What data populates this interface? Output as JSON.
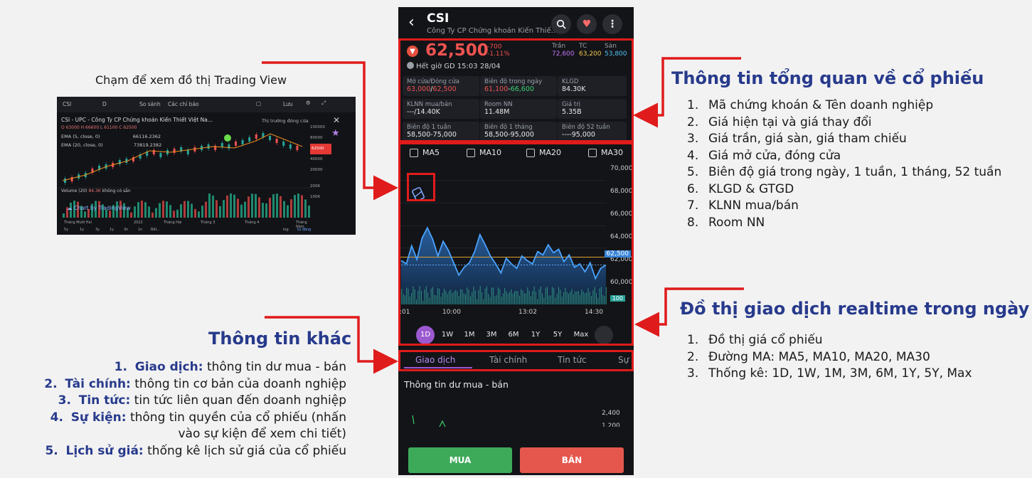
{
  "phone": {
    "symbol": "CSI",
    "company": "Công Ty CP Chứng khoán Kiến Thiế...",
    "price": "62,500",
    "change_abs": "-700",
    "change_pct": "-1.11%",
    "ceiling_label": "Trần",
    "ceiling": "72,600",
    "ref_label": "TC",
    "ref": "63,200",
    "floor_label": "Sàn",
    "floor": "53,800",
    "time": "Hết giờ GD 15:03 28/04",
    "cells": [
      {
        "label": "Mở cửa/Đóng cửa",
        "value_a": "63,000",
        "value_sep": "/",
        "value_b": "62,500",
        "color_a": "#ef5350",
        "color_b": "#ef5350"
      },
      {
        "label": "Biên độ trong ngày",
        "value_a": "61,100",
        "value_sep": "-",
        "value_b": "66,600",
        "color_a": "#ef5350",
        "color_b": "#3ecf6d"
      },
      {
        "label": "KLGD",
        "value": "84.30K"
      },
      {
        "label": "KLNN mua/bán",
        "value": "---/14.40K"
      },
      {
        "label": "Room NN",
        "value": "11.48M"
      },
      {
        "label": "Giá trị",
        "value": "5.35B"
      },
      {
        "label": "Biên độ 1 tuần",
        "value": "58,500-75,000"
      },
      {
        "label": "Biên độ 1 tháng",
        "value": "58,500-95,000"
      },
      {
        "label": "Biên độ 52 tuần",
        "value": "----95,000"
      }
    ],
    "ma": [
      "MA5",
      "MA10",
      "MA20",
      "MA30"
    ],
    "y_ticks": [
      "70,000",
      "68,000",
      "66,000",
      "64,000",
      "62,000",
      "60,000"
    ],
    "x_ticks": [
      ":01",
      "10:00",
      "13:02",
      "14:30"
    ],
    "current_tag": "62,500",
    "volume_tag": "100",
    "periods": [
      "1D",
      "1W",
      "1M",
      "3M",
      "6M",
      "1Y",
      "5Y",
      "Max"
    ],
    "tabs": [
      "Giao dịch",
      "Tài chính",
      "Tin tức",
      "Sự"
    ],
    "subsection": "Thông tin dư mua - bán",
    "mini_ticks": [
      "2,400",
      "1,200"
    ],
    "buy": "MUA",
    "sell": "BÁN"
  },
  "chart_data": {
    "type": "line",
    "title": "",
    "xlabel": "",
    "ylabel": "",
    "x": [
      ":01",
      "10:00",
      "13:02",
      "14:30"
    ],
    "ylim": [
      59000,
      71000
    ],
    "reference_line": 63200,
    "last_value": 62500,
    "series": [
      {
        "values": [
          62900,
          62600,
          64200,
          63000,
          64900,
          65800,
          64800,
          63300,
          64600,
          63800,
          62700,
          61600,
          62300,
          62700,
          63700,
          65200,
          64300,
          63300,
          62600,
          61800,
          63100,
          62600,
          62200,
          63300,
          62900,
          62600,
          63700,
          63400,
          64300,
          63600,
          63900,
          62800,
          63400,
          62300,
          62600,
          61900,
          62700,
          61300,
          62200,
          62500
        ]
      }
    ]
  },
  "tradingview": {
    "caption": "Chạm để xem đồ thị Trading View",
    "symbol": "CSI",
    "interval": "D",
    "compare": "So sánh",
    "indicators": "Các chỉ báo",
    "save": "Lưu",
    "title": "CSI - UPC - Công Ty CP Chứng khoán Kiến Thiết Việt Na...",
    "market": "Thị trường đóng cửa",
    "ohlc": "O 63000  H 66600  L 61100  C 62500",
    "ema1": "EMA (5, close, 0)",
    "ema2": "EMA (20, close, 0)",
    "ema1_val": "66116.2362",
    "ema2_val": "73819.2382",
    "volume_label": "Volume (20)",
    "volume_val": "84.3K",
    "volume_na": "không có sẵn",
    "watermark": "Chart by TradingView",
    "y_ticks": [
      "100000",
      "80000",
      "62500",
      "40000",
      "20000"
    ],
    "vol_ticks": [
      "200K",
      "100K"
    ],
    "x_ticks": [
      "Tháng Mười Hai",
      "2022",
      "Tháng Hai",
      "Tháng 3",
      "Tháng 4",
      "Tháng Năm"
    ],
    "ranges": [
      "5y",
      "1y",
      "3y",
      "1y",
      "3n",
      "1n",
      "Bắt..."
    ],
    "log": "log",
    "auto": "tự động"
  },
  "annotations": {
    "overview_title": "Thông tin tổng quan về cổ phiếu",
    "overview_items": [
      "Mã chứng khoán & Tên doanh nghiệp",
      "Giá hiện tại và giá thay đổi",
      "Giá trần, giá sàn, giá tham chiếu",
      "Giá mở cửa, đóng cửa",
      "Biên độ giá trong ngày, 1 tuần, 1 tháng, 52 tuần",
      "KLGD & GTGD",
      "KLNN mua/bán",
      "Room NN"
    ],
    "realtime_title": "Đồ thị giao dịch realtime trong ngày",
    "realtime_items": [
      "Đồ thị giá cổ phiếu",
      "Đường MA: MA5, MA10, MA20, MA30",
      "Thống kê: 1D, 1W, 1M, 3M, 6M, 1Y, 5Y, Max"
    ],
    "other_title": "Thông tin khác",
    "other_items": [
      {
        "num": "1.",
        "bold": "Giao dịch:",
        "text": " thông tin dư mua - bán"
      },
      {
        "num": "2.",
        "bold": "Tài chính:",
        "text": " thông tin cơ bản của doanh nghiệp"
      },
      {
        "num": "3.",
        "bold": "Tin tức:",
        "text": " tin tức liên quan đến doanh nghiệp"
      },
      {
        "num": "4.",
        "bold": "Sự kiện:",
        "text": " thông tin quyền của cổ phiếu (nhấn",
        "cont": "vào sự kiện để xem chi tiết)"
      },
      {
        "num": "5.",
        "bold": "Lịch sử giá:",
        "text": " thống kê lịch sử giá của cổ phiếu"
      }
    ]
  },
  "colors": {
    "accent_purple": "#9b59d0",
    "down": "#ef5350",
    "up": "#3ecf6d",
    "annotation_red": "#e01b1b",
    "title_blue": "#273a8c"
  }
}
